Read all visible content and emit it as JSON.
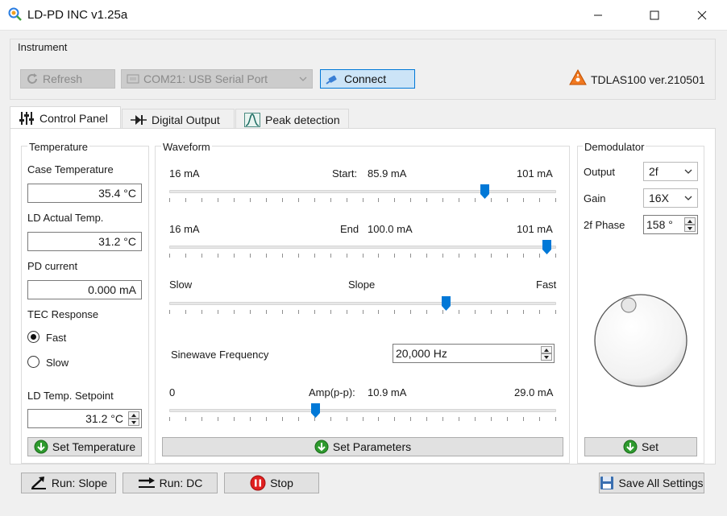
{
  "window": {
    "title": "LD-PD INC v1.25a"
  },
  "instrument": {
    "group_label": "Instrument",
    "refresh_label": "Refresh",
    "port_value": "COM21: USB Serial Port",
    "connect_label": "Connect",
    "device_label": "TDLAS100 ver.210501"
  },
  "tabs": [
    {
      "label": "Control Panel"
    },
    {
      "label": "Digital Output"
    },
    {
      "label": "Peak detection"
    }
  ],
  "temperature": {
    "group_label": "Temperature",
    "case_label": "Case Temperature",
    "case_value": "35.4 °C",
    "ld_actual_label": "LD Actual Temp.",
    "ld_actual_value": "31.2 °C",
    "pd_current_label": "PD current",
    "pd_current_value": "0.000 mA",
    "tec_label": "TEC Response",
    "tec_fast": "Fast",
    "tec_slow": "Slow",
    "tec_selected": "Fast",
    "setpoint_label": "LD Temp. Setpoint",
    "setpoint_value": "31.2 °C",
    "set_button": "Set Temperature"
  },
  "waveform": {
    "group_label": "Waveform",
    "start": {
      "min": "16 mA",
      "label": "Start:",
      "value": "85.9 mA",
      "max": "101 mA",
      "fraction": 0.822
    },
    "end": {
      "min": "16 mA",
      "label": "End",
      "value": "100.0 mA",
      "max": "101 mA",
      "fraction": 0.988
    },
    "slope": {
      "min": "Slow",
      "label": "Slope",
      "max": "Fast",
      "fraction": 0.72
    },
    "sine_label": "Sinewave Frequency",
    "sine_value": "20,000 Hz",
    "amp": {
      "min": "0",
      "label": "Amp(p-p):",
      "value": "10.9 mA",
      "max": "29.0 mA",
      "fraction": 0.376
    },
    "set_button": "Set Parameters"
  },
  "demodulator": {
    "group_label": "Demodulator",
    "output_label": "Output",
    "output_value": "2f",
    "gain_label": "Gain",
    "gain_value": "16X",
    "phase_label": "2f Phase",
    "phase_value": "158 °",
    "set_button": "Set"
  },
  "footer": {
    "run_slope": "Run: Slope",
    "run_dc": "Run: DC",
    "stop": "Stop",
    "save": "Save All Settings"
  },
  "colors": {
    "accent": "#0078d7",
    "green": "#2e9a2e",
    "red": "#e02020",
    "orange": "#f07820"
  }
}
